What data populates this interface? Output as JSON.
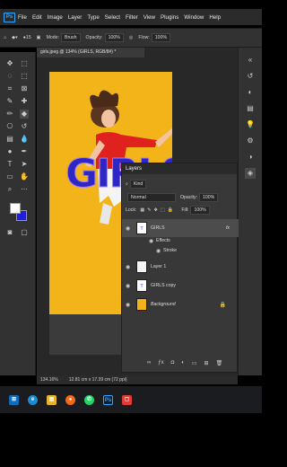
{
  "menu": {
    "items": [
      "File",
      "Edit",
      "Image",
      "Layer",
      "Type",
      "Select",
      "Filter",
      "View",
      "Plugins",
      "Window",
      "Help"
    ]
  },
  "options": {
    "brush_size": "15",
    "mode_label": "Mode:",
    "mode_value": "Brush",
    "opacity_label": "Opacity:",
    "opacity_value": "100%",
    "flow_label": "Flow:",
    "flow_value": "100%"
  },
  "document": {
    "tab_title": "girls.jpeg @ 134% (GIRLS, RGB/8#) *",
    "canvas_text": "GIRLS"
  },
  "layers_panel": {
    "title": "Layers",
    "filter_value": "Kind",
    "blend_mode": "Normal",
    "opacity_label": "Opacity:",
    "opacity_value": "100%",
    "lock_label": "Lock:",
    "fill_label": "Fill:",
    "fill_value": "100%",
    "layers": [
      {
        "name": "GIRLS",
        "fx": "fx"
      },
      {
        "name": "Effects"
      },
      {
        "name": "Stroke"
      },
      {
        "name": "Layer 1"
      },
      {
        "name": "GIRLS copy"
      },
      {
        "name": "Background"
      }
    ]
  },
  "status": {
    "zoom": "134.16%",
    "doc_size": "12.81 cm x 17.39 cm (72 ppi)"
  },
  "taskbar": {
    "ps_label": "Ps"
  },
  "colors": {
    "canvas_bg": "#f3b419",
    "text_fill": "#2f27c4",
    "accent": "#31a8ff",
    "foreground": "#ffffff",
    "background": "#1f1fdc"
  }
}
